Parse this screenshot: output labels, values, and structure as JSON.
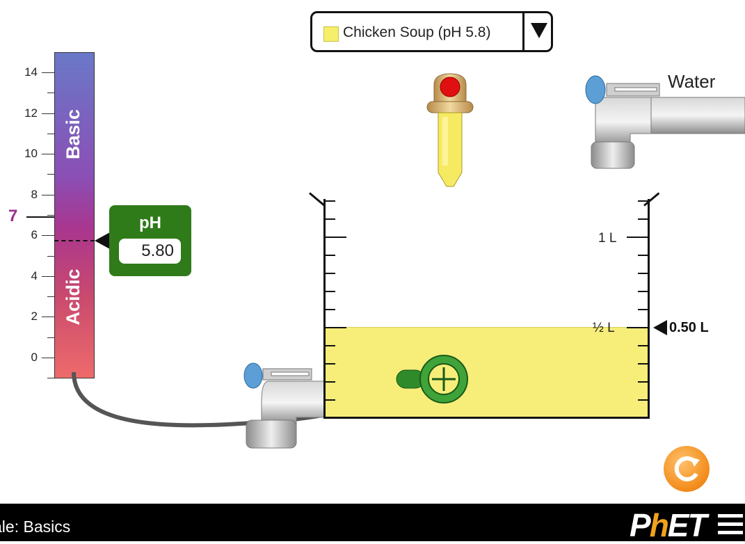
{
  "solute_selector": {
    "label": "Chicken Soup (pH 5.8)",
    "swatch_color": "#f5ef6a"
  },
  "water_faucet": {
    "label": "Water"
  },
  "ph_meter": {
    "title": "pH",
    "value": "5.80",
    "basic_label": "Basic",
    "acidic_label": "Acidic",
    "neutral_label": "7",
    "tick_labels": [
      "14",
      "12",
      "10",
      "8",
      "6",
      "4",
      "2",
      "0"
    ]
  },
  "beaker": {
    "label_1L": "1 L",
    "label_half": "½ L",
    "volume_readout": "0.50 L",
    "fill_fraction": 0.5,
    "liquid_color": "#f7ee7a"
  },
  "navbar": {
    "sim_title": "ale: Basics",
    "logo_p": "P",
    "logo_h": "h",
    "logo_et": "ET"
  },
  "colors": {
    "meter_box": "#2f7a19",
    "neutral": "#9b2f8e",
    "reset": "#f28c1a",
    "probe": "#2f8a2a"
  }
}
